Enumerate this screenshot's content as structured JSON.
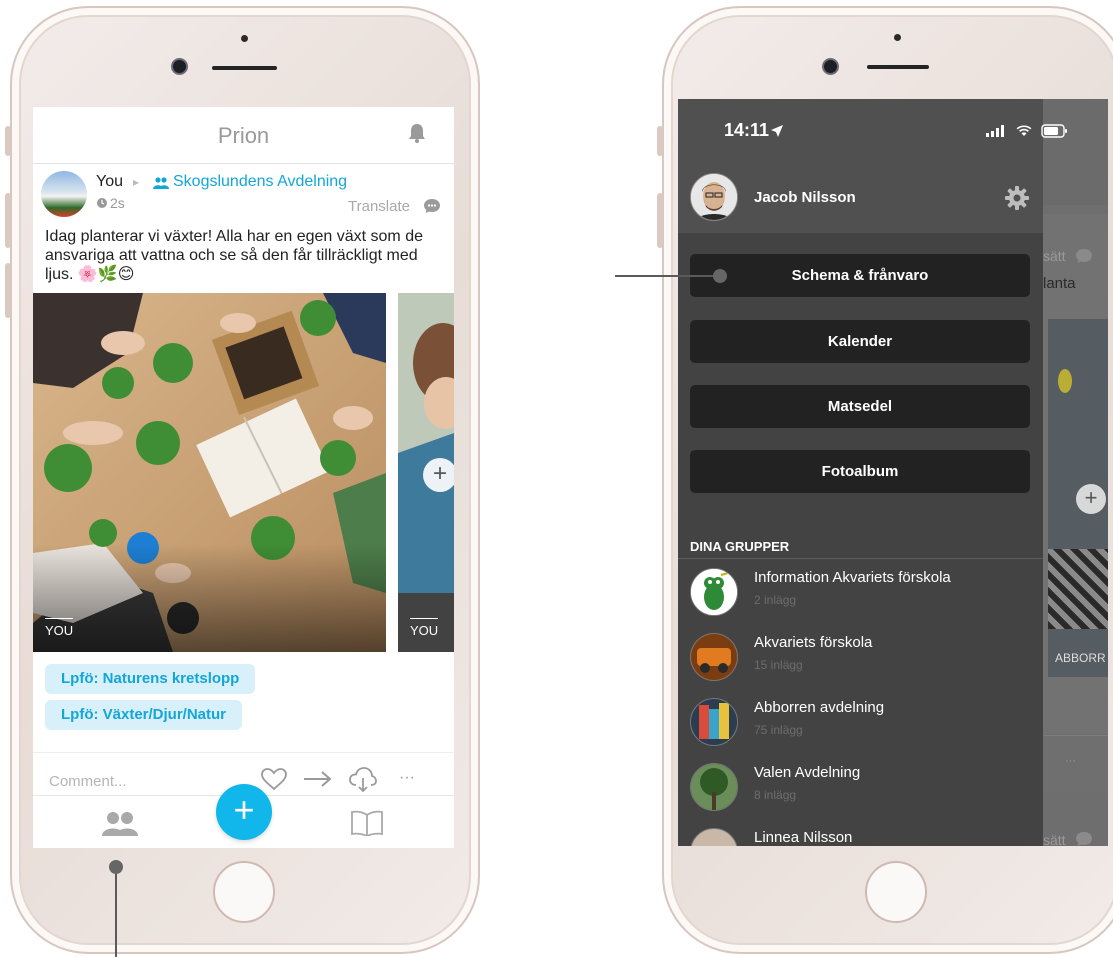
{
  "left_app": {
    "title": "Prion",
    "post": {
      "author": "You",
      "arrow": "▸",
      "group": "Skogslundens Avdelning",
      "time": "2s",
      "translate": "Translate",
      "text": "Idag planterar vi växter! Alla har en egen växt som de ansvariga att vattna och se så den får tillräckligt med ljus. 🌸🌿😊",
      "photo_label_1": "YOU",
      "photo_label_2": "YOU",
      "add_symbol": "+",
      "tags": [
        "Lpfö: Naturens kretslopp",
        "Lpfö: Växter/Djur/Natur"
      ],
      "comment_placeholder": "Comment...",
      "more": "···"
    },
    "tabbar": {
      "fab_symbol": "+"
    }
  },
  "right_app": {
    "status": {
      "time": "14:11"
    },
    "user_name": "Jacob Nilsson",
    "menu_buttons": [
      "Schema & frånvaro",
      "Kalender",
      "Matsedel",
      "Fotoalbum"
    ],
    "groups_header": "DINA GRUPPER",
    "groups": [
      {
        "name": "Information Akvariets förskola",
        "count": "2 inlägg",
        "color": "#2f8a38"
      },
      {
        "name": "Akvariets förskola",
        "count": "15 inlägg",
        "color": "#d2691e"
      },
      {
        "name": "Abborren avdelning",
        "count": "75 inlägg",
        "color": "#4a7a9a"
      },
      {
        "name": "Valen Avdelning",
        "count": "8 inlägg",
        "color": "#3c6b2f"
      },
      {
        "name": "Linnea Nilsson",
        "count": "",
        "color": "#c9b7a8"
      }
    ],
    "behind": {
      "translate_fragment_1": "sätt",
      "text_fragment": "lanta",
      "photo_label": "ABBORR",
      "more": "···",
      "translate_fragment_2": "sätt",
      "add_symbol": "+"
    }
  },
  "colors": {
    "accent": "#11b7ea",
    "tag_bg": "#d8f0fa",
    "menu_bg": "#434343",
    "button_bg": "#222222"
  }
}
